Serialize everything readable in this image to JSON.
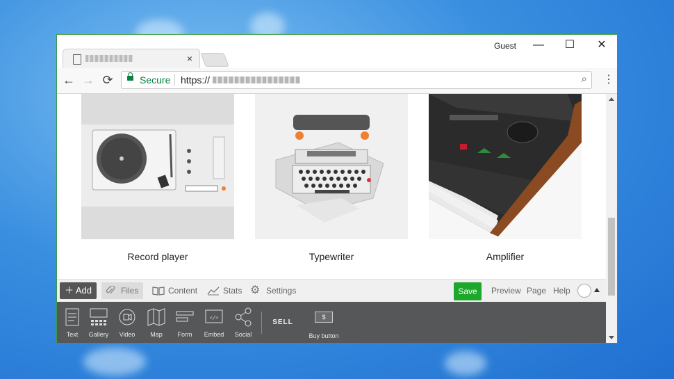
{
  "browser": {
    "tab_title": "",
    "tab_close": "×",
    "profile": "Guest",
    "window_controls": {
      "minimize": "—",
      "maximize": "☐",
      "close": "✕"
    },
    "nav": {
      "back": "←",
      "forward": "→",
      "reload": "⟳"
    },
    "security_label": "Secure",
    "url_prefix": "https://",
    "zoom_icon": "⌕",
    "menu_icon": "⋮"
  },
  "products": [
    {
      "caption": "Record player"
    },
    {
      "caption": "Typewriter"
    },
    {
      "caption": "Amplifier"
    }
  ],
  "editor_toolbar": {
    "add": "Add",
    "files": "Files",
    "content": "Content",
    "stats": "Stats",
    "settings": "Settings",
    "save": "Save",
    "preview": "Preview",
    "page": "Page",
    "help": "Help"
  },
  "element_panel": {
    "items": [
      "Text",
      "Gallery",
      "Video",
      "Map",
      "Form",
      "Embed",
      "Social"
    ],
    "sell_label": "SELL",
    "buy_button": "Buy button",
    "buy_symbol": "$"
  },
  "colors": {
    "save_button": "#1ea82b",
    "secure_green": "#0b8043",
    "panel_bg": "#555758",
    "desktop_bg": "#3a8fe0"
  }
}
